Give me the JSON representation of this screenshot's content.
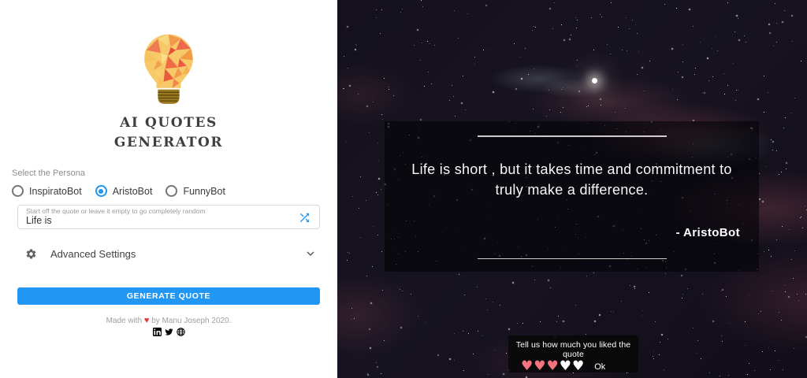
{
  "app": {
    "title_line1": "AI QUOTES",
    "title_line2": "GENERATOR"
  },
  "persona": {
    "label": "Select the Persona",
    "options": [
      {
        "label": "InspiratoBot",
        "selected": false
      },
      {
        "label": "AristoBot",
        "selected": true
      },
      {
        "label": "FunnyBot",
        "selected": false
      }
    ]
  },
  "seed_input": {
    "floating_label": "Start off the quote or leave it empty to go completely random",
    "value": "Life is",
    "icon": "shuffle-icon"
  },
  "advanced_settings": {
    "label": "Advanced Settings",
    "left_icon": "gear-icon",
    "right_icon": "chevron-down-icon"
  },
  "generate_button": {
    "label": "GENERATE QUOTE"
  },
  "footer": {
    "credit_prefix": "Made with",
    "heart": "♥",
    "credit_suffix": "by Manu Joseph 2020.",
    "social_icons": [
      "linkedin-icon",
      "twitter-icon",
      "globe-icon"
    ]
  },
  "quote_card": {
    "text": "Life is short , but it takes time and commitment to truly make a difference.",
    "attribution": "- AristoBot"
  },
  "rating_toast": {
    "message": "Tell us how much you liked the quote",
    "hearts_filled": 3,
    "hearts_total": 5,
    "heart_glyph": "♥",
    "ok_label": "Ok"
  },
  "colors": {
    "accent_blue": "#2196f3",
    "heart_pink": "#f4737f",
    "heart_red": "#e53935"
  }
}
